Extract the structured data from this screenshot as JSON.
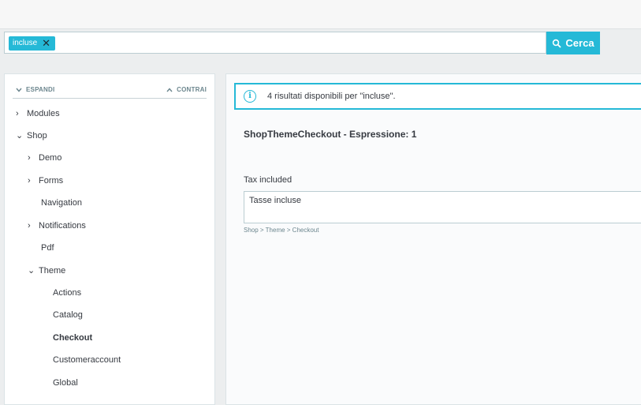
{
  "search": {
    "tag": "incluse",
    "button_label": "Cerca"
  },
  "tree": {
    "expand_label": "ESPANDI",
    "collapse_label": "CONTRAI",
    "nodes": [
      {
        "label": "Modules",
        "chevron": "right"
      },
      {
        "label": "Shop",
        "chevron": "down"
      },
      {
        "label": "Demo",
        "chevron": "right"
      },
      {
        "label": "Forms",
        "chevron": "right"
      },
      {
        "label": "Navigation",
        "chevron": ""
      },
      {
        "label": "Notifications",
        "chevron": "right"
      },
      {
        "label": "Pdf",
        "chevron": ""
      },
      {
        "label": "Theme",
        "chevron": "down"
      },
      {
        "label": "Actions",
        "chevron": ""
      },
      {
        "label": "Catalog",
        "chevron": ""
      },
      {
        "label": "Checkout",
        "chevron": "",
        "selected": true
      },
      {
        "label": "Customeraccount",
        "chevron": ""
      },
      {
        "label": "Global",
        "chevron": ""
      }
    ]
  },
  "main": {
    "alert_text": "4 risultati disponibili per \"incluse\".",
    "result_title": "ShopThemeCheckout - Espressione: 1",
    "original_text": "Tax included",
    "translation_value": "Tasse incluse",
    "breadcrumb": "Shop > Theme > Checkout"
  },
  "colors": {
    "accent": "#25b9d7",
    "text": "#363a41",
    "muted": "#6c868e"
  }
}
